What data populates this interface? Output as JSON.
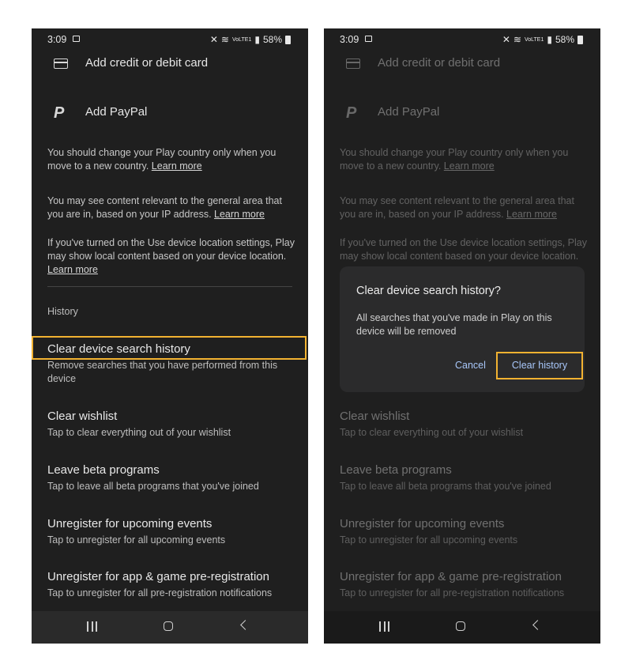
{
  "status": {
    "time": "3:09",
    "battery": "58%",
    "network": "VoLTE1"
  },
  "payment": {
    "card_label": "Add credit or debit card",
    "paypal_label": "Add PayPal"
  },
  "info": {
    "country_text": "You should change your Play country only when you move to a new country.",
    "country_link": "Learn more",
    "ip_text": "You may see content relevant to the general area that you are in, based on your IP address.",
    "ip_link": "Learn more",
    "location_text": "If you've turned on the Use device location settings, Play may show local content based on your device location.",
    "location_link": "Learn more"
  },
  "history": {
    "section_label": "History",
    "items": [
      {
        "title": "Clear device search history",
        "subtitle": "Remove searches that you have performed from this device"
      },
      {
        "title": "Clear wishlist",
        "subtitle": "Tap to clear everything out of your wishlist"
      },
      {
        "title": "Leave beta programs",
        "subtitle": "Tap to leave all beta programs that you've joined"
      },
      {
        "title": "Unregister for upcoming events",
        "subtitle": "Tap to unregister for all upcoming events"
      },
      {
        "title": "Unregister for app & game pre-registration",
        "subtitle": "Tap to unregister for all pre-registration notifications"
      }
    ]
  },
  "dialog": {
    "title": "Clear device search history?",
    "body": "All searches that you've made in Play on this device will be removed",
    "cancel_label": "Cancel",
    "confirm_label": "Clear history"
  },
  "colors": {
    "highlight": "#f2b231",
    "accent_text": "#a8c7fa",
    "background": "#1f1f1f"
  }
}
